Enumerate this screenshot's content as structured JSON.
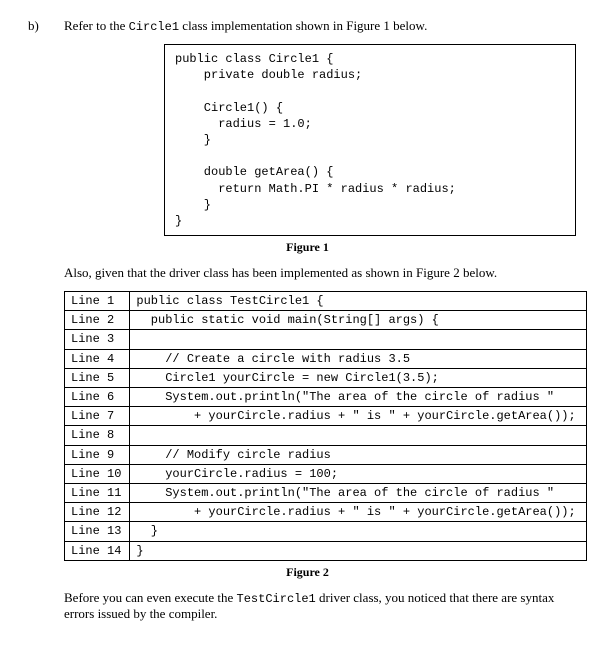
{
  "question": {
    "label": "b)",
    "intro_pre": "Refer to the ",
    "class_name": "Circle1",
    "intro_post": " class implementation shown in Figure 1 below."
  },
  "figure1": {
    "code": "public class Circle1 {\n    private double radius;\n\n    Circle1() {\n      radius = 1.0;\n    }\n\n    double getArea() {\n      return Math.PI * radius * radius;\n    }\n}",
    "caption": "Figure 1"
  },
  "mid_para": "Also, given that the driver class has been implemented as shown in Figure 2 below.",
  "figure2": {
    "lines": [
      {
        "label": "Line 1",
        "code": "public class TestCircle1 {"
      },
      {
        "label": "Line 2",
        "code": "  public static void main(String[] args) {"
      },
      {
        "label": "Line 3",
        "code": ""
      },
      {
        "label": "Line 4",
        "code": "    // Create a circle with radius 3.5"
      },
      {
        "label": "Line 5",
        "code": "    Circle1 yourCircle = new Circle1(3.5);"
      },
      {
        "label": "Line 6",
        "code": "    System.out.println(\"The area of the circle of radius \""
      },
      {
        "label": "Line 7",
        "code": "        + yourCircle.radius + \" is \" + yourCircle.getArea());"
      },
      {
        "label": "Line 8",
        "code": ""
      },
      {
        "label": "Line 9",
        "code": "    // Modify circle radius"
      },
      {
        "label": "Line 10",
        "code": "    yourCircle.radius = 100;"
      },
      {
        "label": "Line 11",
        "code": "    System.out.println(\"The area of the circle of radius \""
      },
      {
        "label": "Line 12",
        "code": "        + yourCircle.radius + \" is \" + yourCircle.getArea());"
      },
      {
        "label": "Line 13",
        "code": "  }"
      },
      {
        "label": "Line 14",
        "code": "}"
      }
    ],
    "caption": "Figure 2"
  },
  "closing": {
    "pre": "Before you can even execute the ",
    "class_name": "TestCircle1",
    "post": " driver class, you noticed that there are syntax errors issued by the compiler."
  }
}
